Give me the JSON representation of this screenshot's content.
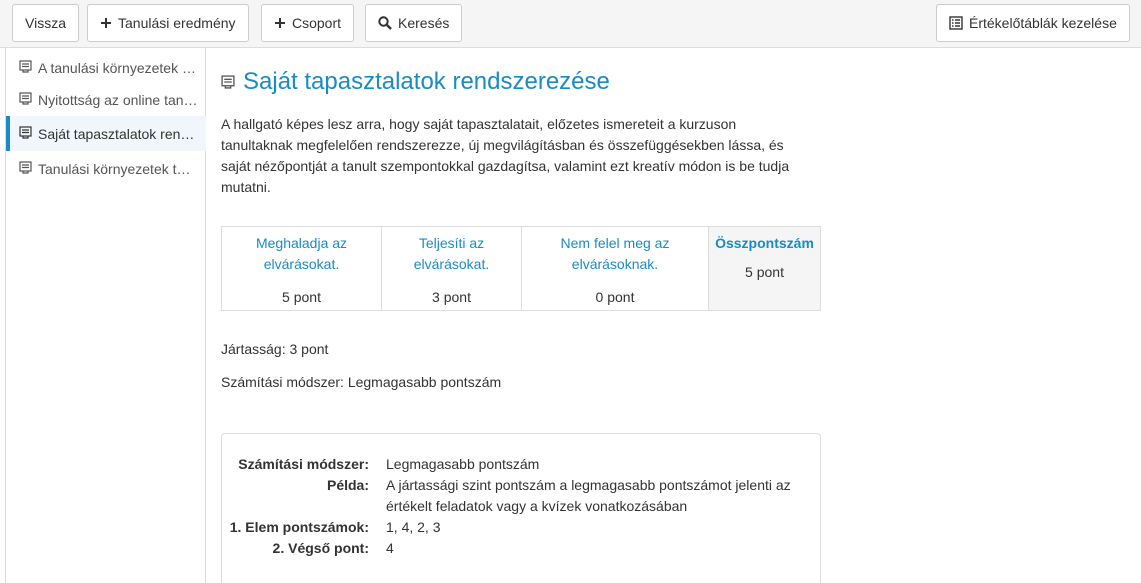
{
  "toolbar": {
    "back_label": "Vissza",
    "add_outcome_label": "Tanulási eredmény",
    "add_group_label": "Csoport",
    "search_label": "Keresés",
    "manage_label": "Értékelőtáblák kezelése"
  },
  "sidebar": {
    "items": [
      {
        "label": "A tanulási környezetek létrehozása"
      },
      {
        "label": "Nyitottság az online tanulásra"
      },
      {
        "label": "Saját tapasztalatok rendszerezése"
      },
      {
        "label": "Tanulási környezetek tervezése"
      }
    ]
  },
  "main": {
    "title": "Saját tapasztalatok rendszerezése",
    "description": "A hallgató képes lesz arra, hogy saját tapasztalatait, előzetes ismereteit a kurzuson tanultaknak megfelelően rendszerezze, új megvilágításban és összefüggésekben lássa, és saját nézőpontját a tanult szempontokkal gazdagítsa, valamint ezt kreatív módon is be tudja mutatni.",
    "criteria": [
      {
        "label": "Meghaladja az elvárásokat.",
        "points": "5 pont"
      },
      {
        "label": "Teljesíti az elvárásokat.",
        "points": "3 pont"
      },
      {
        "label": "Nem felel meg az elvárásoknak.",
        "points": "0 pont"
      }
    ],
    "total": {
      "label": "Összpontszám",
      "points": "5 pont"
    },
    "mastery": "Jártasság: 3 pont",
    "calc_method": "Számítási módszer: Legmagasabb pontszám",
    "method_box": {
      "rows": [
        {
          "key": "Számítási módszer:",
          "value": "Legmagasabb pontszám"
        },
        {
          "key": "Példa:",
          "value": "A jártassági szint pontszám a legmagasabb pontszámot jelenti az értékelt feladatok vagy a kvízek vonatkozásában"
        },
        {
          "key": "1. Elem pontszámok:",
          "value": "1, 4, 2, 3"
        },
        {
          "key": "2. Végső pont:",
          "value": "4"
        }
      ]
    }
  },
  "colors": {
    "accent": "#1a8bc4",
    "border": "#dddddd",
    "toolbar_bg": "#f5f5f5",
    "active_bg": "#f0f6fb"
  },
  "icons": [
    "plus-icon",
    "search-icon",
    "list-icon",
    "document-icon"
  ]
}
